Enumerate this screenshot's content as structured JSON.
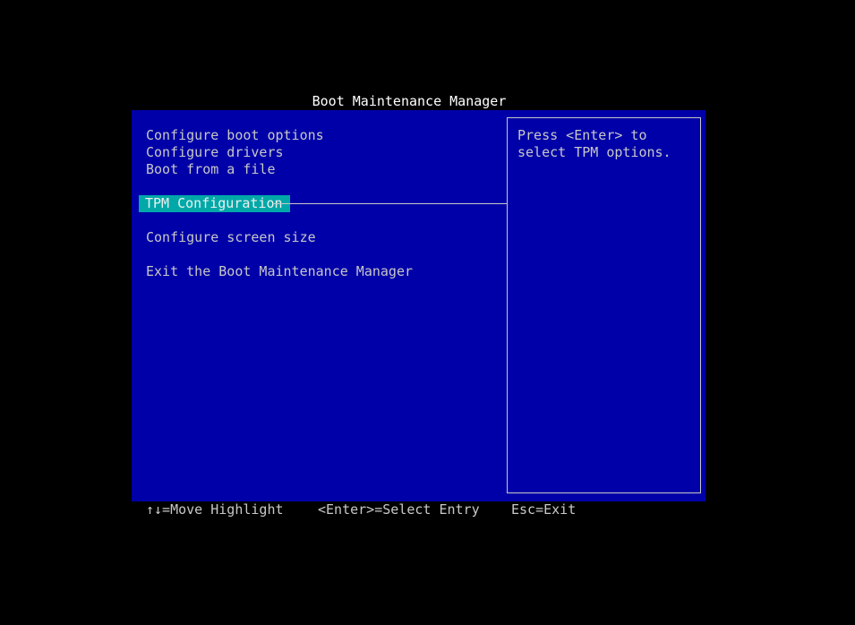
{
  "title": "Boot Maintenance Manager",
  "menu": {
    "items": [
      {
        "label": "Configure boot options"
      },
      {
        "label": "Configure drivers"
      },
      {
        "label": "Boot from a file"
      },
      {
        "label": "TPM Configuration",
        "selected": true
      },
      {
        "label": "Configure screen size"
      },
      {
        "label": "Exit the Boot Maintenance Manager"
      }
    ]
  },
  "help": {
    "lines": [
      "Press <Enter> to",
      "select TPM options."
    ]
  },
  "footer": {
    "move": "↑↓=Move Highlight",
    "select": "<Enter>=Select Entry",
    "exit": "Esc=Exit"
  },
  "colors": {
    "screen_background": "#000000",
    "panel_background": "#0000a8",
    "highlight_background": "#00a8a8",
    "text": "#c8c8c8",
    "title_text": "#ffffff"
  }
}
